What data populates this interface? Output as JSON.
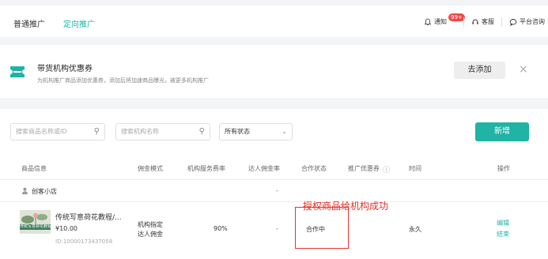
{
  "tabs": [
    {
      "label": "普通推广"
    },
    {
      "label": "定向推广"
    }
  ],
  "topright": {
    "notify_label": "通知",
    "notify_badge": "99+",
    "service_label": "客服",
    "consult_label": "平台咨询"
  },
  "coupon": {
    "title": "带货机构优惠券",
    "desc": "为机构推广商品添加优惠券，添加后将加速商品曝光，被更多机构推广",
    "add_label": "去添加",
    "close_symbol": "×"
  },
  "filters": {
    "product_placeholder": "搜索商品名称或ID",
    "org_placeholder": "搜索机构名称",
    "status_value": "所有状态"
  },
  "new_button": "新增",
  "columns": [
    "商品信息",
    "佣金模式",
    "机构服务费率",
    "达人佣金率",
    "合作状态",
    "推广优惠券",
    "时间",
    "操作"
  ],
  "group": {
    "name": "创客小店",
    "dash": "-"
  },
  "row": {
    "title": "传统写意荷花教程/...",
    "price": "¥10.00",
    "id": "ID:10000173437058",
    "thumb_text": "传统写意荷花教程",
    "mode_line1": "机构指定",
    "mode_line2": "达人佣金",
    "rate": "90%",
    "talent_rate": "-",
    "status": "合作中",
    "time": "永久",
    "edit": "编辑",
    "end": "结束"
  },
  "annotation": {
    "text": "授权商品给机构成功",
    "color": "#e8302a"
  },
  "colors": {
    "accent": "#1fb4a4",
    "badge": "#f04848"
  }
}
